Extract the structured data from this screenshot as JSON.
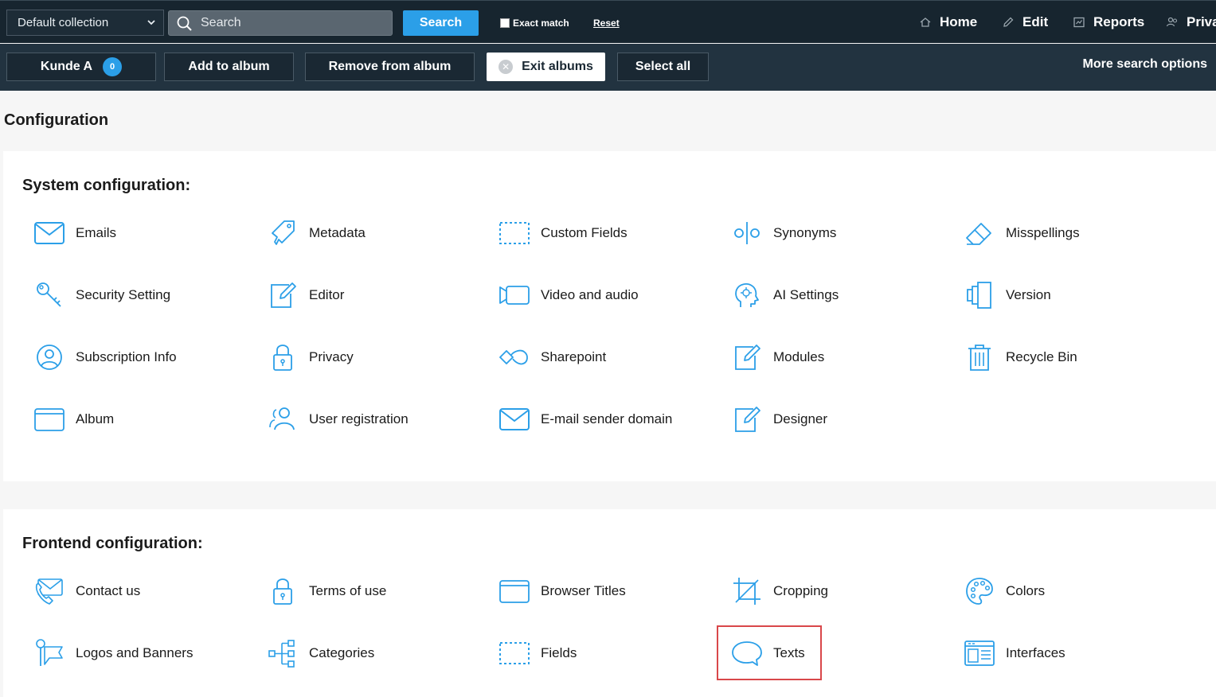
{
  "topbar": {
    "collection": "Default collection",
    "search_placeholder": "Search",
    "search_button": "Search",
    "exact_match": "Exact match",
    "reset": "Reset",
    "nav": {
      "home": "Home",
      "edit": "Edit",
      "reports": "Reports",
      "privacy_truncated": "Priva"
    }
  },
  "subbar": {
    "album_name": "Kunde A",
    "album_count": "0",
    "add_to_album": "Add to album",
    "remove_from_album": "Remove from album",
    "exit_albums": "Exit albums",
    "select_all": "Select all",
    "more_search_options": "More search options"
  },
  "page": {
    "title": "Configuration"
  },
  "system": {
    "title": "System configuration:",
    "items": {
      "emails": "Emails",
      "metadata": "Metadata",
      "custom_fields": "Custom Fields",
      "synonyms": "Synonyms",
      "misspellings": "Misspellings",
      "security": "Security Setting",
      "editor": "Editor",
      "video": "Video and audio",
      "ai": "AI Settings",
      "version": "Version",
      "subscription": "Subscription Info",
      "privacy": "Privacy",
      "sharepoint": "Sharepoint",
      "modules": "Modules",
      "recycle": "Recycle Bin",
      "album": "Album",
      "user_reg": "User registration",
      "email_domain": "E-mail sender domain",
      "designer": "Designer"
    }
  },
  "frontend": {
    "title": "Frontend configuration:",
    "items": {
      "contact": "Contact us",
      "terms": "Terms of use",
      "browser_titles": "Browser Titles",
      "cropping": "Cropping",
      "colors": "Colors",
      "logos": "Logos and Banners",
      "categories": "Categories",
      "fields": "Fields",
      "texts": "Texts",
      "interfaces": "Interfaces"
    }
  },
  "colors": {
    "topbar_bg": "#17252f",
    "subbar_bg": "#223340",
    "accent": "#2b9fe8",
    "icon": "#2b9fe8",
    "highlight": "#d9474a"
  }
}
